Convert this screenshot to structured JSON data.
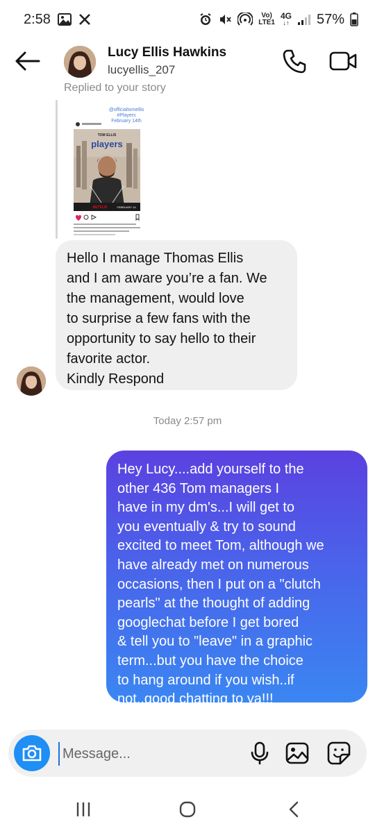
{
  "status_bar": {
    "time": "2:58",
    "network_top": "Vo)",
    "network_bottom": "LTE1",
    "network_type": "4G",
    "battery": "57%"
  },
  "header": {
    "name": "Lucy Ellis Hawkins",
    "username": "lucyellis_207"
  },
  "story_reply": {
    "label": "Replied to your story",
    "story_caption_lines": [
      "@officialtomellis",
      "#Players",
      "February 14th"
    ],
    "poster_actor": "TOM ELLIS",
    "poster_title": "players",
    "poster_brand": "NETFLIX",
    "poster_date": "FEBRUARY 14"
  },
  "messages": {
    "received": {
      "lines": [
        "Hello I manage Thomas Ellis",
        "and I am aware you’re a fan. We",
        "the management, would love",
        "to surprise a few fans with the",
        "opportunity to say hello to their",
        "favorite actor.",
        "Kindly Respond"
      ]
    },
    "timestamp": "Today 2:57 pm",
    "sent": {
      "lines": [
        "Hey Lucy....add yourself to the",
        "other  436 Tom managers I",
        "have in my dm's...I  will get to",
        "you eventually & try to sound",
        "excited to meet Tom, although we",
        "have already met on numerous",
        "occasions, then I put on a \"clutch",
        "pearls\" at the thought of adding",
        "googlechat before I get bored",
        "& tell you to \"leave\" in a graphic",
        "term...but you have the choice",
        "to hang around if you wish..if",
        "not..good chatting to ya!!!"
      ]
    }
  },
  "composer": {
    "placeholder": "Message..."
  },
  "colors": {
    "camera_button": "#1f8ef5",
    "sent_gradient_top": "#5b41e0",
    "sent_gradient_bottom": "#3a86f2",
    "received_bubble": "#efefef"
  }
}
